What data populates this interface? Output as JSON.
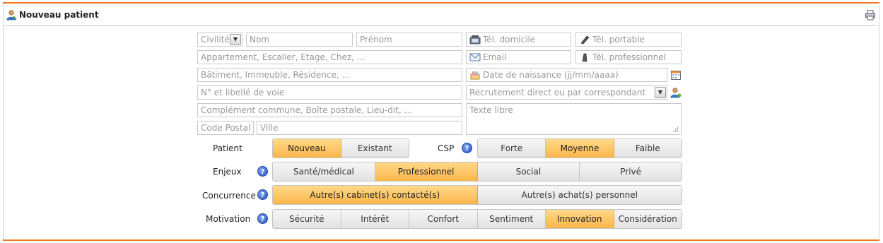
{
  "header": {
    "title": "Nouveau patient",
    "icon": "user-icon",
    "print_icon": "printer-icon"
  },
  "form": {
    "civilite": "Civilité",
    "nom": "Nom",
    "prenom": "Prénom",
    "tel_domicile": "Tél. domicile",
    "tel_portable": "Tél. portable",
    "appartement": "Appartement, Escalier, Etage, Chez, ...",
    "email": "Email",
    "tel_professionnel": "Tél. professionnel",
    "batiment": "Bâtiment, Immeuble, Résidence, ...",
    "date_naissance": "Date de naissance (jj/mm/aaaa)",
    "voie": "N° et libellé de voie",
    "recrutement": "Recrutement direct ou par correspondant",
    "complement": "Complément commune, Boîte postale, Lieu-dit, ...",
    "texte_libre": "Texte libre",
    "code_postal": "Code Postal",
    "ville": "Ville"
  },
  "patient": {
    "label": "Patient",
    "options": [
      "Nouveau",
      "Existant"
    ],
    "selected": "Nouveau"
  },
  "csp": {
    "label": "CSP",
    "options": [
      "Forte",
      "Moyenne",
      "Faible"
    ],
    "selected": "Moyenne"
  },
  "enjeux": {
    "label": "Enjeux",
    "options": [
      "Santé/médical",
      "Professionnel",
      "Social",
      "Privé"
    ],
    "selected": "Professionnel"
  },
  "concurrence": {
    "label": "Concurrence",
    "options": [
      "Autre(s) cabinet(s) contacté(s)",
      "Autre(s) achat(s) personnel"
    ],
    "selected": "Autre(s) cabinet(s) contacté(s)"
  },
  "motivation": {
    "label": "Motivation",
    "options": [
      "Sécurité",
      "Intérêt",
      "Confort",
      "Sentiment",
      "Innovation",
      "Considération"
    ],
    "selected": "Innovation"
  },
  "colors": {
    "accent": "#f07a22",
    "selected_segment": "#fbb64a",
    "help_icon": "#2a57c9"
  }
}
